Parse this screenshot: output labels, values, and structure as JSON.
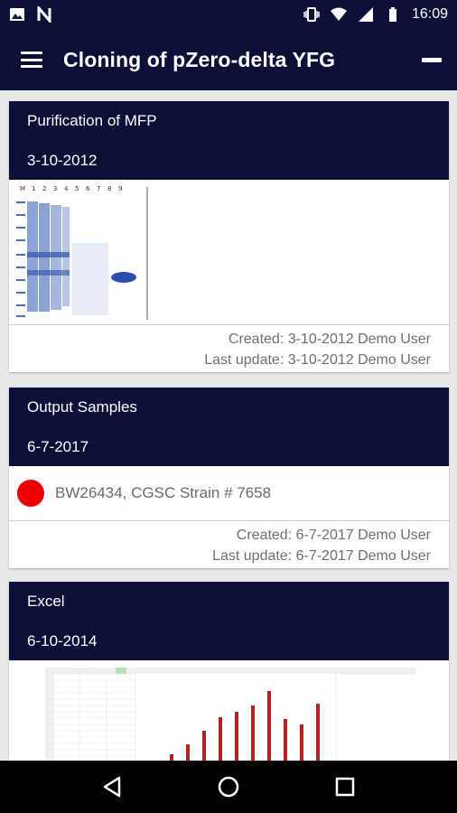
{
  "status_bar": {
    "time": "16:09",
    "icons": [
      "image-icon",
      "n-icon",
      "vibrate-icon",
      "wifi-icon",
      "signal-icon",
      "battery-icon"
    ]
  },
  "app_bar": {
    "title": "Cloning of pZero-delta YFG",
    "menu_icon": "hamburger-icon",
    "collapse_icon": "collapse-icon"
  },
  "cards": [
    {
      "title": "Purification of MFP",
      "date": "3-10-2012",
      "image": "gel-electrophoresis-image",
      "gel_lane_labels": [
        "M",
        "1",
        "2",
        "3",
        "4",
        "5",
        "6",
        "7",
        "8",
        "9"
      ],
      "created": "Created: 3-10-2012 Demo User",
      "updated": "Last update: 3-10-2012 Demo User"
    },
    {
      "title": "Output Samples",
      "date": "6-7-2017",
      "sample_color": "#ee0000",
      "sample_text": "BW26434, CGSC Strain # 7658",
      "created": "Created: 6-7-2017 Demo User",
      "updated": "Last update: 6-7-2017 Demo User"
    },
    {
      "title": "Excel",
      "date": "6-10-2014",
      "image": "spreadsheet-chart-image"
    }
  ],
  "nav_bar": {
    "icons": [
      "back-icon",
      "home-icon",
      "recents-icon"
    ]
  },
  "colors": {
    "header_bg": "#0c1038",
    "accent_red": "#ee0000",
    "meta_text": "#6f6f6f"
  }
}
